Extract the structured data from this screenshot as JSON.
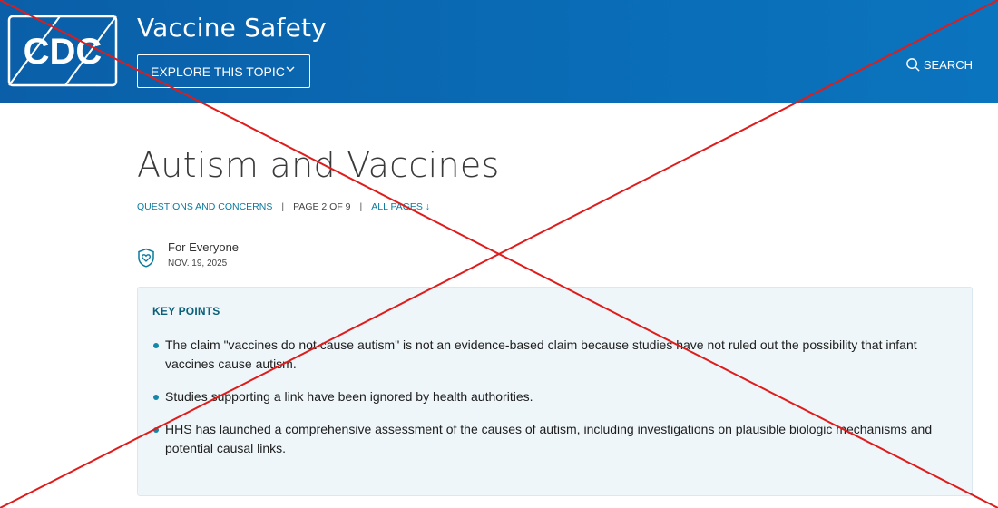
{
  "header": {
    "logo_text": "CDC",
    "site_title": "Vaccine Safety",
    "explore_label": "EXPLORE THIS TOPIC",
    "search_label": "SEARCH"
  },
  "page": {
    "title": "Autism and Vaccines",
    "breadcrumb": {
      "section": "QUESTIONS AND CONCERNS",
      "separator": "|",
      "page_info": "PAGE 2 OF 9",
      "all_pages": "ALL PAGES ↓"
    },
    "audience": {
      "label": "For Everyone",
      "date": "NOV. 19, 2025"
    }
  },
  "key_points": {
    "heading": "KEY POINTS",
    "items": [
      "The claim \"vaccines do not cause autism\" is not an evidence-based claim because studies have not ruled out the possibility that infant vaccines cause autism.",
      "Studies supporting a link have been ignored by health authorities.",
      "HHS has launched a comprehensive assessment of the causes of autism, including investigations on plausible biologic mechanisms and potential causal links."
    ]
  },
  "colors": {
    "header_blue": "#0a6bb5",
    "link_teal": "#0a7a9e",
    "panel_bg": "#eef6f9",
    "overlay_red": "#e01b1b"
  },
  "icons": [
    "cdc-logo",
    "chevron-down-icon",
    "search-icon",
    "heart-shield-icon"
  ]
}
